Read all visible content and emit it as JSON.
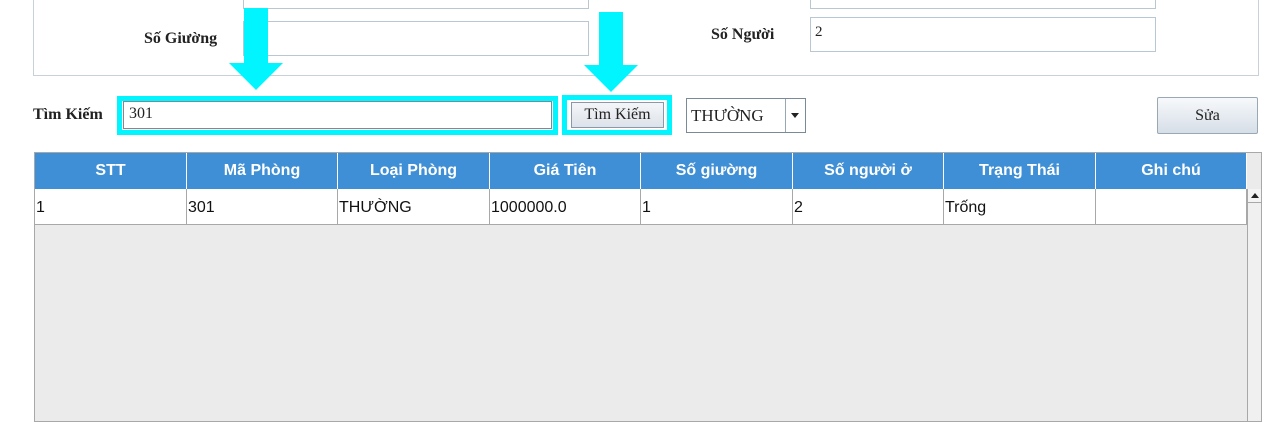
{
  "form": {
    "so_giuong_label": "Số Giường",
    "so_giuong_value": "",
    "so_nguoi_label": "Số Người",
    "so_nguoi_value": "2"
  },
  "search": {
    "label": "Tìm Kiếm",
    "value": "301",
    "button_label": "Tìm Kiếm"
  },
  "room_type_select": {
    "selected": "THƯỜNG"
  },
  "edit_button_label": "Sửa",
  "table": {
    "columns": [
      "STT",
      "Mã Phòng",
      "Loại Phòng",
      "Giá Tiên",
      "Số giường",
      "Số người ở",
      "Trạng Thái",
      "Ghi chú"
    ],
    "rows": [
      [
        "1",
        "301",
        "THƯỜNG",
        "1000000.0",
        "1",
        "2",
        "Trống",
        ""
      ]
    ]
  },
  "colors": {
    "header_bg": "#3f8fd6",
    "highlight": "#00f5ff",
    "table_empty_bg": "#ebebeb"
  }
}
